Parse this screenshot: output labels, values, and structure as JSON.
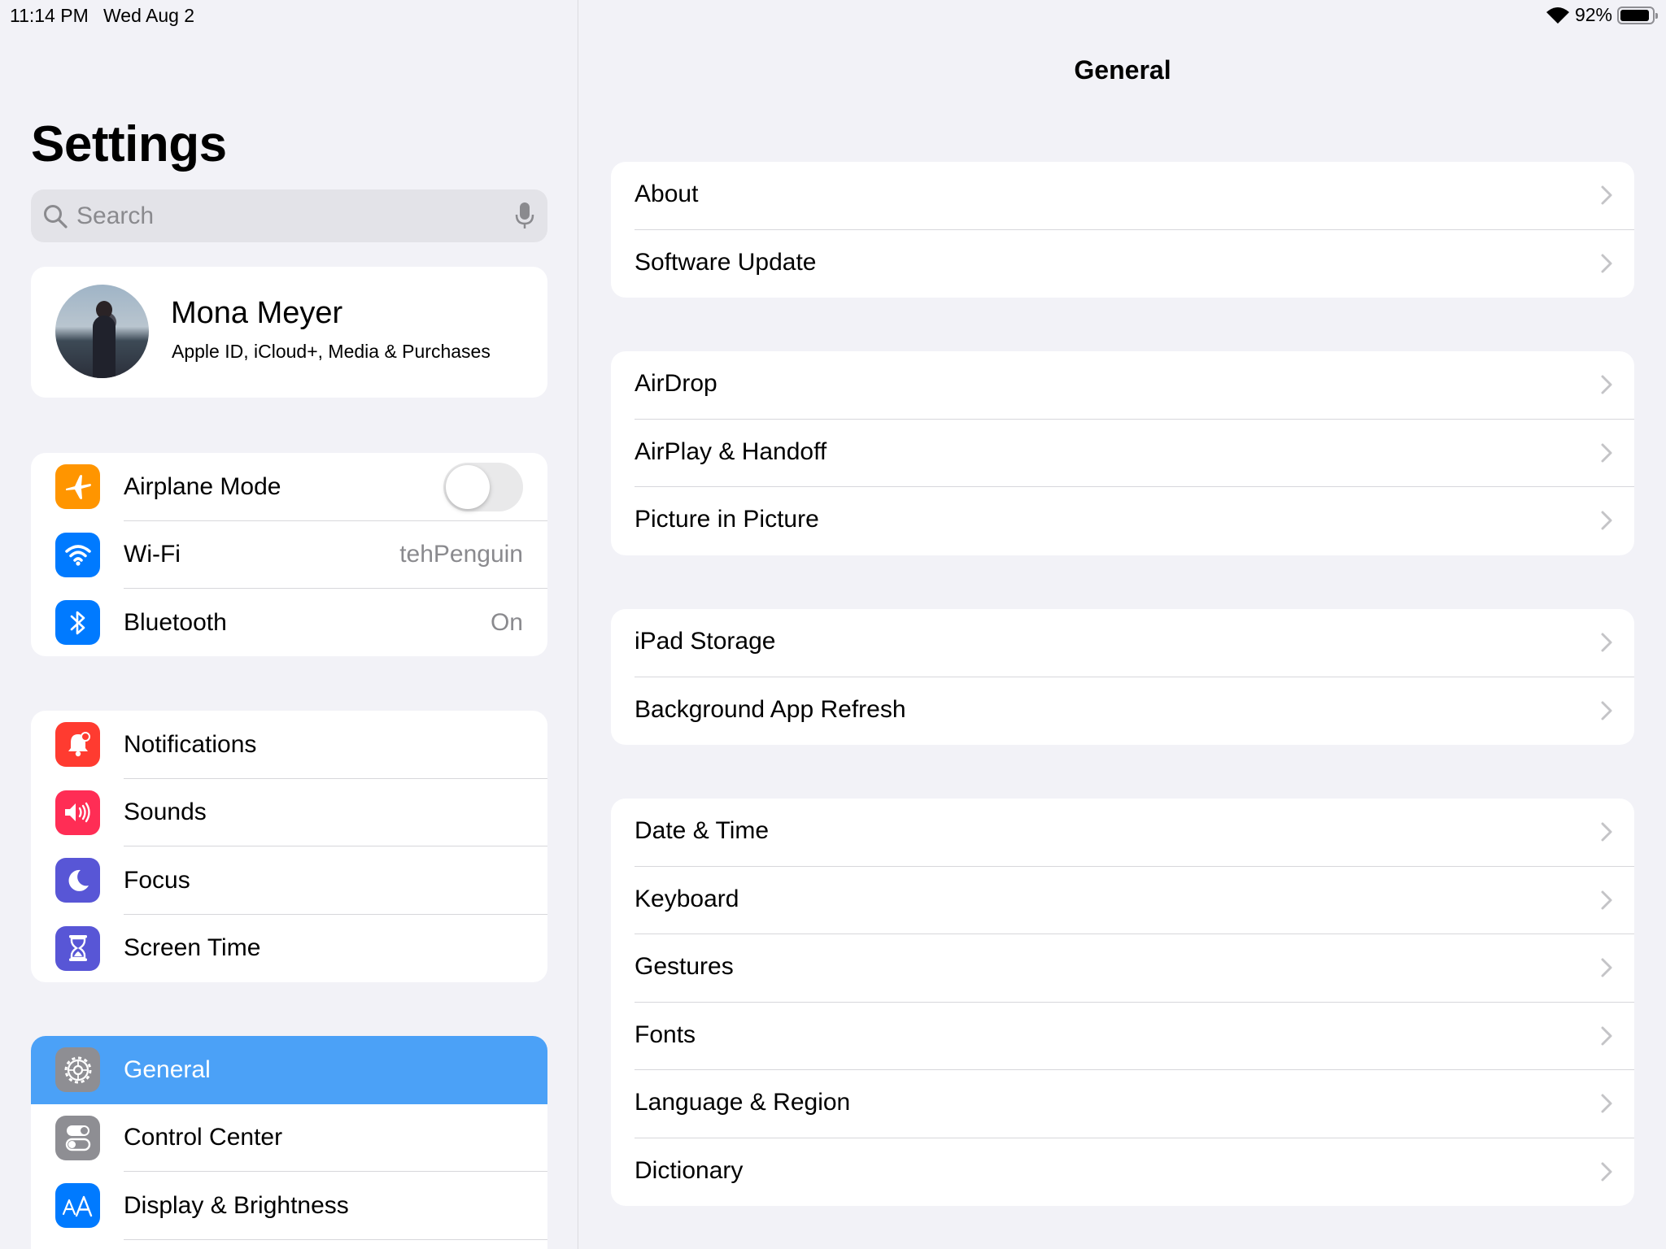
{
  "status_bar": {
    "time": "11:14 PM",
    "date": "Wed Aug 2",
    "battery": "92%",
    "battery_level": 0.92
  },
  "sidebar": {
    "title": "Settings",
    "search": {
      "placeholder": "Search"
    },
    "profile": {
      "name": "Mona Meyer",
      "subtitle": "Apple ID, iCloud+, Media & Purchases"
    },
    "connectivity": [
      {
        "label": "Airplane Mode",
        "value": "",
        "icon": "airplane-icon",
        "color": "#ff9500",
        "toggle": "off"
      },
      {
        "label": "Wi-Fi",
        "value": "tehPenguin",
        "icon": "wifi-icon",
        "color": "#007aff"
      },
      {
        "label": "Bluetooth",
        "value": "On",
        "icon": "bluetooth-icon",
        "color": "#007aff"
      }
    ],
    "notifications_group": [
      {
        "label": "Notifications",
        "icon": "bell-icon",
        "color": "#ff3b30"
      },
      {
        "label": "Sounds",
        "icon": "speaker-icon",
        "color": "#ff2d55"
      },
      {
        "label": "Focus",
        "icon": "moon-icon",
        "color": "#5856d6"
      },
      {
        "label": "Screen Time",
        "icon": "hourglass-icon",
        "color": "#5856d6"
      }
    ],
    "general_group": [
      {
        "label": "General",
        "icon": "gear-icon",
        "color": "#8e8e93",
        "selected": true
      },
      {
        "label": "Control Center",
        "icon": "switches-icon",
        "color": "#8e8e93"
      },
      {
        "label": "Display & Brightness",
        "icon": "text-size-icon",
        "color": "#007aff"
      }
    ],
    "selected_color": "#4ba1f7"
  },
  "detail": {
    "title": "General",
    "groups": [
      [
        "About",
        "Software Update"
      ],
      [
        "AirDrop",
        "AirPlay & Handoff",
        "Picture in Picture"
      ],
      [
        "iPad Storage",
        "Background App Refresh"
      ],
      [
        "Date & Time",
        "Keyboard",
        "Gestures",
        "Fonts",
        "Language & Region",
        "Dictionary"
      ]
    ]
  }
}
